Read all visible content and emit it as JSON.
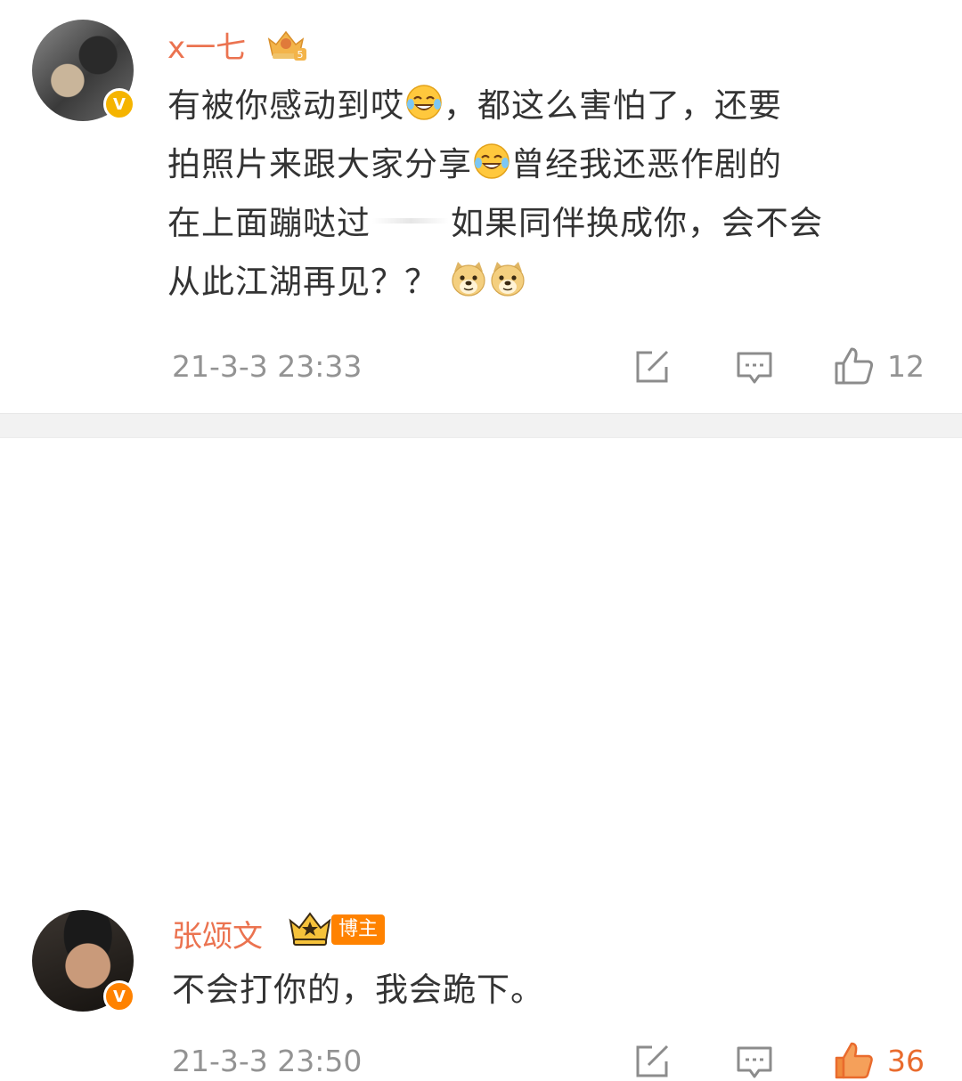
{
  "comments": [
    {
      "username": "x一七",
      "text_lines": [
        "有被你感动到哎",
        "，都这么害怕了，还要",
        "拍照片来跟大家分享",
        "曾经我还恶作剧的",
        "在上面蹦哒过",
        "如果同伴换成你，会不会",
        "从此江湖再见？？"
      ],
      "timestamp": "21-3-3 23:33",
      "like_count": "12",
      "liked": false,
      "badge_level": "5",
      "verified": "V"
    },
    {
      "username": "张颂文",
      "tag": "博主",
      "text": "不会打你的，我会跪下。",
      "timestamp": "21-3-3 23:50",
      "like_count": "36",
      "liked": true,
      "verified": "V"
    }
  ],
  "colors": {
    "username": "#eb7350",
    "like_active": "#e96b2d",
    "muted": "#939393",
    "text": "#333333",
    "gold_badge": "#f5b400",
    "orange_badge": "#ff8200"
  },
  "icons": [
    "share-icon",
    "comment-icon",
    "like-icon",
    "laugh-cry-emoji",
    "doge-emoji",
    "crown-badge-icon"
  ]
}
